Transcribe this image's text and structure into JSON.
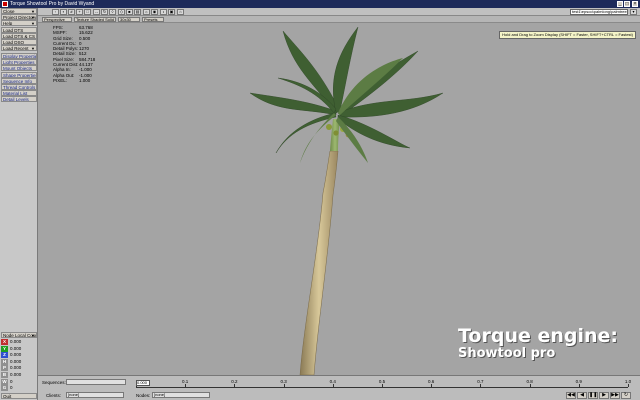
{
  "window": {
    "title": "Torque Showtool Pro by David Wyand"
  },
  "sidebar": {
    "buttons": [
      "Close",
      "Project Directory",
      "Help",
      "Load DTS",
      "Load DTS & CS",
      "Load DSQ",
      "Load Recent",
      "Display Properties",
      "Light Properties",
      "Mount Objects",
      "Shape Properties",
      "Sequence Info",
      "Thread Controls",
      "Material List",
      "Detail Levels"
    ],
    "node_label": "Node Local Coor",
    "coords": [
      {
        "label": "X",
        "value": "0.000",
        "color": "#c03030"
      },
      {
        "label": "Y",
        "value": "0.000",
        "color": "#20a020"
      },
      {
        "label": "Z",
        "value": "0.000",
        "color": "#3050d0"
      },
      {
        "label": "H",
        "value": "0.000",
        "color": "#909090"
      },
      {
        "label": "P",
        "value": "0.000",
        "color": "#909090"
      },
      {
        "label": "B",
        "value": "0.000",
        "color": "#909090"
      },
      {
        "label": "W",
        "value": "0",
        "color": "#909090"
      },
      {
        "label": "G",
        "value": "0",
        "color": "#909090"
      }
    ],
    "quit": "Quit"
  },
  "toolbar": {
    "path": "test1\\epsoo\\palmlong\\palmtrees\\pine.dts"
  },
  "viewbar": {
    "view": "Perspective",
    "shading": "Texture Shaded Solid",
    "grid": "30x30",
    "presets": "Presets"
  },
  "stats": [
    {
      "k": "FPS:",
      "v": "63.768"
    },
    {
      "k": "MSPF:",
      "v": "15.622"
    },
    {
      "k": "Grid Size:",
      "v": "0.500"
    },
    {
      "k": "Current DL:",
      "v": "0"
    },
    {
      "k": "Detail Polys:",
      "v": "1270"
    },
    {
      "k": "Detail Size:",
      "v": "512"
    },
    {
      "k": "Pixel Size:",
      "v": "584.718"
    },
    {
      "k": "Current Dist:",
      "v": "44.137"
    },
    {
      "k": "Alpha In:",
      "v": "-1.000"
    },
    {
      "k": "Alpha Out:",
      "v": "-1.000"
    },
    {
      "k": "PIXEL:",
      "v": "1.000"
    }
  ],
  "tooltip": "Hold and Drag to Zoom Display (SHIFT = Faster, SHIFT+CTRL = Fastest)",
  "watermark": {
    "line1": "Torque engine:",
    "line2": "Showtool pro"
  },
  "timeline": {
    "sequences_label": "Sequences:",
    "clients_label": "Clients:",
    "clients_value": "[none]",
    "nodes_label": "Nodes:",
    "nodes_value": "[none]",
    "time_value": "0.000",
    "ticks": [
      "0",
      "0.1",
      "0.2",
      "0.3",
      "0.4",
      "0.5",
      "0.6",
      "0.7",
      "0.8",
      "0.9",
      "1.0"
    ]
  },
  "colors": {
    "titlebar": "#1d2a5a",
    "viewport": "#a4a4a4",
    "panel": "#c8c8c8"
  }
}
